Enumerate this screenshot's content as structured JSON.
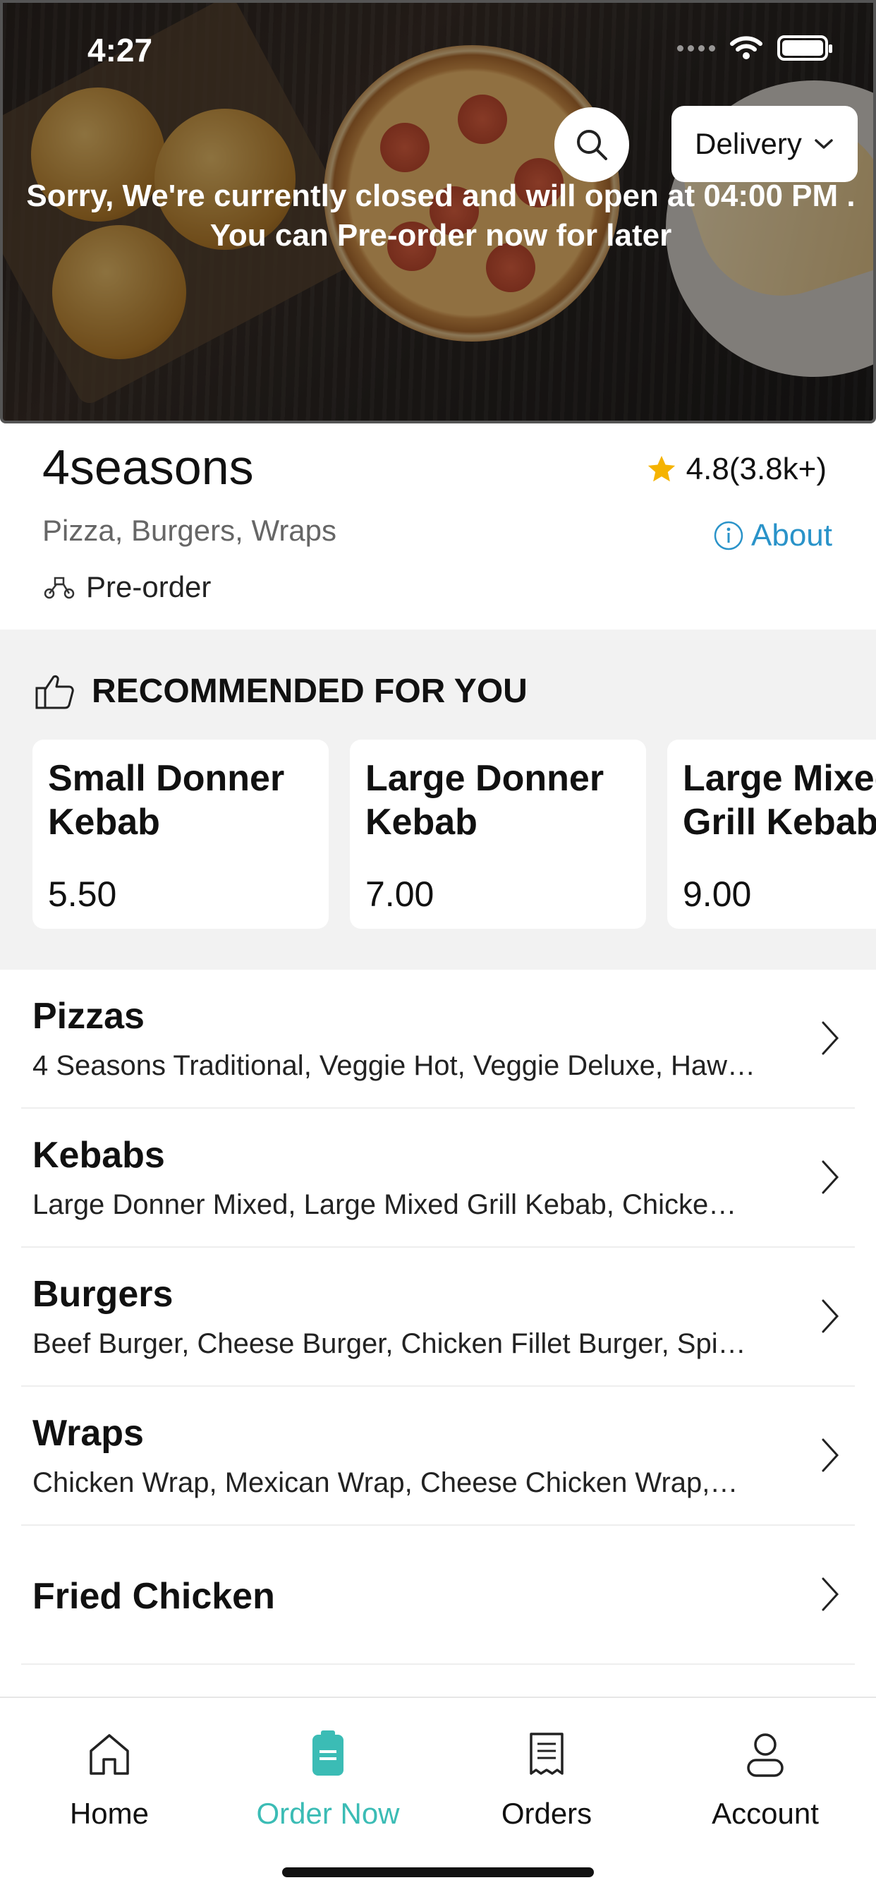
{
  "status_bar": {
    "time": "4:27"
  },
  "header": {
    "delivery_label": "Delivery",
    "closed_message_line1": "Sorry, We're currently closed and will open at 04:00 PM .",
    "closed_message_line2": "You can Pre-order now for later"
  },
  "restaurant": {
    "name": "4seasons",
    "rating": "4.8(3.8k+)",
    "cuisine": "Pizza, Burgers, Wraps",
    "about_label": "About",
    "order_mode": "Pre-order"
  },
  "recommended": {
    "heading": "RECOMMENDED FOR YOU",
    "items": [
      {
        "name": "Small Donner\nKebab",
        "price": "5.50"
      },
      {
        "name": "Large Donner\nKebab",
        "price": "7.00"
      },
      {
        "name": "Large Mixed\nGrill Kebab",
        "price": "9.00"
      }
    ]
  },
  "categories": [
    {
      "name": "Pizzas",
      "items": "4 Seasons Traditional, Veggie Hot, Veggie Deluxe, Haw…"
    },
    {
      "name": "Kebabs",
      "items": "Large Donner Mixed, Large Mixed Grill Kebab, Chicke…"
    },
    {
      "name": "Burgers",
      "items": "Beef Burger, Cheese Burger, Chicken Fillet Burger, Spi…"
    },
    {
      "name": "Wraps",
      "items": "Chicken Wrap, Mexican Wrap, Cheese Chicken Wrap,…"
    },
    {
      "name": "Fried Chicken",
      "items": ""
    }
  ],
  "tabs": [
    {
      "label": "Home",
      "icon": "home-icon"
    },
    {
      "label": "Order Now",
      "icon": "order-icon"
    },
    {
      "label": "Orders",
      "icon": "receipt-icon"
    },
    {
      "label": "Account",
      "icon": "user-icon"
    }
  ],
  "colors": {
    "accent": "#3bbcb5",
    "link": "#2a93c9",
    "star": "#f5b301"
  }
}
